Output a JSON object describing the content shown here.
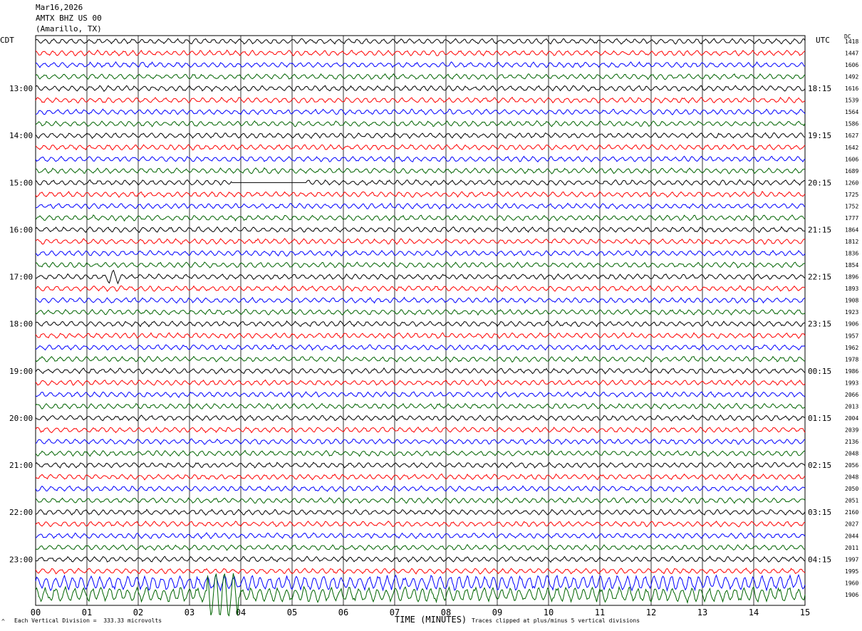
{
  "header": {
    "date": "Mar16,2026",
    "station": "AMTX BHZ US 00",
    "location": "(Amarillo, TX)"
  },
  "left_zone": "CDT",
  "right_zone": "UTC",
  "right_col_header": "DC",
  "footer": {
    "scale_note": "Each Vertical Division =  333.33 microvolts",
    "xlabel": "TIME (MINUTES)",
    "clip_note": "Traces clipped at plus/minus 5 vertical divisions",
    "corner_mark": "^"
  },
  "colors": {
    "trace_cycle": [
      "#000000",
      "#ff0000",
      "#0000ff",
      "#006400"
    ],
    "grid": "#000000"
  },
  "chart_data": {
    "type": "line",
    "subtype": "helicorder",
    "xlabel": "TIME (MINUTES)",
    "xlim": [
      0,
      15
    ],
    "x_ticks": [
      "00",
      "01",
      "02",
      "03",
      "04",
      "05",
      "06",
      "07",
      "08",
      "09",
      "10",
      "11",
      "12",
      "13",
      "14",
      "15"
    ],
    "rows_per_hour": 4,
    "left_hour_labels": [
      "13:00",
      "14:00",
      "15:00",
      "16:00",
      "17:00",
      "18:00",
      "19:00",
      "20:00",
      "21:00",
      "22:00",
      "23:00"
    ],
    "right_hour_labels": [
      "18:15",
      "19:15",
      "20:15",
      "21:15",
      "22:15",
      "23:15",
      "00:15",
      "01:15",
      "02:15",
      "03:15",
      "04:15"
    ],
    "row_dc_values": [
      1418,
      1447,
      1606,
      1492,
      1616,
      1539,
      1564,
      1586,
      1627,
      1642,
      1606,
      1689,
      1260,
      1725,
      1752,
      1777,
      1864,
      1812,
      1836,
      1854,
      1896,
      1893,
      1908,
      1923,
      1906,
      1957,
      1962,
      1978,
      1986,
      1993,
      2066,
      2013,
      2004,
      2039,
      2136,
      2048,
      2056,
      2048,
      2050,
      2051,
      2160,
      2027,
      2044,
      2011,
      1997,
      1995,
      1960,
      1906
    ],
    "clip_divisions": 5,
    "vertical_division_microvolts": 333.33,
    "grid": true
  }
}
